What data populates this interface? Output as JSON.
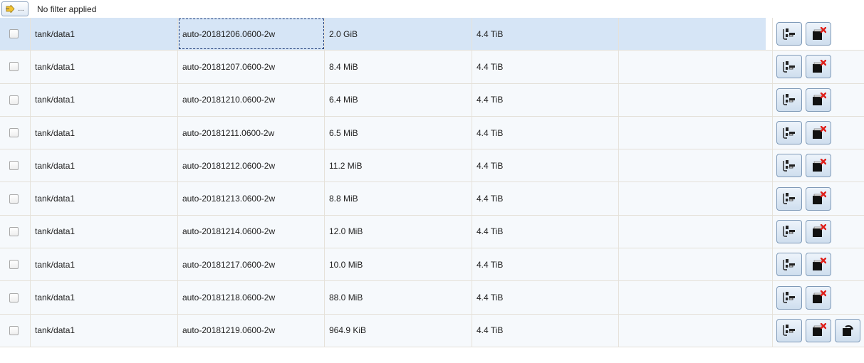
{
  "filter": {
    "button_label": "...",
    "status_text": "No filter applied"
  },
  "rows": [
    {
      "dataset": "tank/data1",
      "snapshot": "auto-20181206.0600-2w",
      "used": "2.0 GiB",
      "refer": "4.4 TiB",
      "selected": true,
      "actions": [
        "clone",
        "destroy"
      ]
    },
    {
      "dataset": "tank/data1",
      "snapshot": "auto-20181207.0600-2w",
      "used": "8.4 MiB",
      "refer": "4.4 TiB",
      "actions": [
        "clone",
        "destroy"
      ]
    },
    {
      "dataset": "tank/data1",
      "snapshot": "auto-20181210.0600-2w",
      "used": "6.4 MiB",
      "refer": "4.4 TiB",
      "actions": [
        "clone",
        "destroy"
      ]
    },
    {
      "dataset": "tank/data1",
      "snapshot": "auto-20181211.0600-2w",
      "used": "6.5 MiB",
      "refer": "4.4 TiB",
      "actions": [
        "clone",
        "destroy"
      ]
    },
    {
      "dataset": "tank/data1",
      "snapshot": "auto-20181212.0600-2w",
      "used": "11.2 MiB",
      "refer": "4.4 TiB",
      "actions": [
        "clone",
        "destroy"
      ]
    },
    {
      "dataset": "tank/data1",
      "snapshot": "auto-20181213.0600-2w",
      "used": "8.8 MiB",
      "refer": "4.4 TiB",
      "actions": [
        "clone",
        "destroy"
      ]
    },
    {
      "dataset": "tank/data1",
      "snapshot": "auto-20181214.0600-2w",
      "used": "12.0 MiB",
      "refer": "4.4 TiB",
      "actions": [
        "clone",
        "destroy"
      ]
    },
    {
      "dataset": "tank/data1",
      "snapshot": "auto-20181217.0600-2w",
      "used": "10.0 MiB",
      "refer": "4.4 TiB",
      "actions": [
        "clone",
        "destroy"
      ]
    },
    {
      "dataset": "tank/data1",
      "snapshot": "auto-20181218.0600-2w",
      "used": "88.0 MiB",
      "refer": "4.4 TiB",
      "actions": [
        "clone",
        "destroy"
      ]
    },
    {
      "dataset": "tank/data1",
      "snapshot": "auto-20181219.0600-2w",
      "used": "964.9 KiB",
      "refer": "4.4 TiB",
      "actions": [
        "clone",
        "destroy",
        "rollback"
      ]
    }
  ],
  "icons": {
    "filter": "filter-arrow-icon",
    "clone": "clone-snapshot-icon",
    "destroy": "destroy-snapshot-icon",
    "rollback": "rollback-snapshot-icon"
  },
  "colors": {
    "selected_row": "#d6e5f6",
    "row": "#f6f9fc",
    "destroy_x": "#e0201b"
  }
}
